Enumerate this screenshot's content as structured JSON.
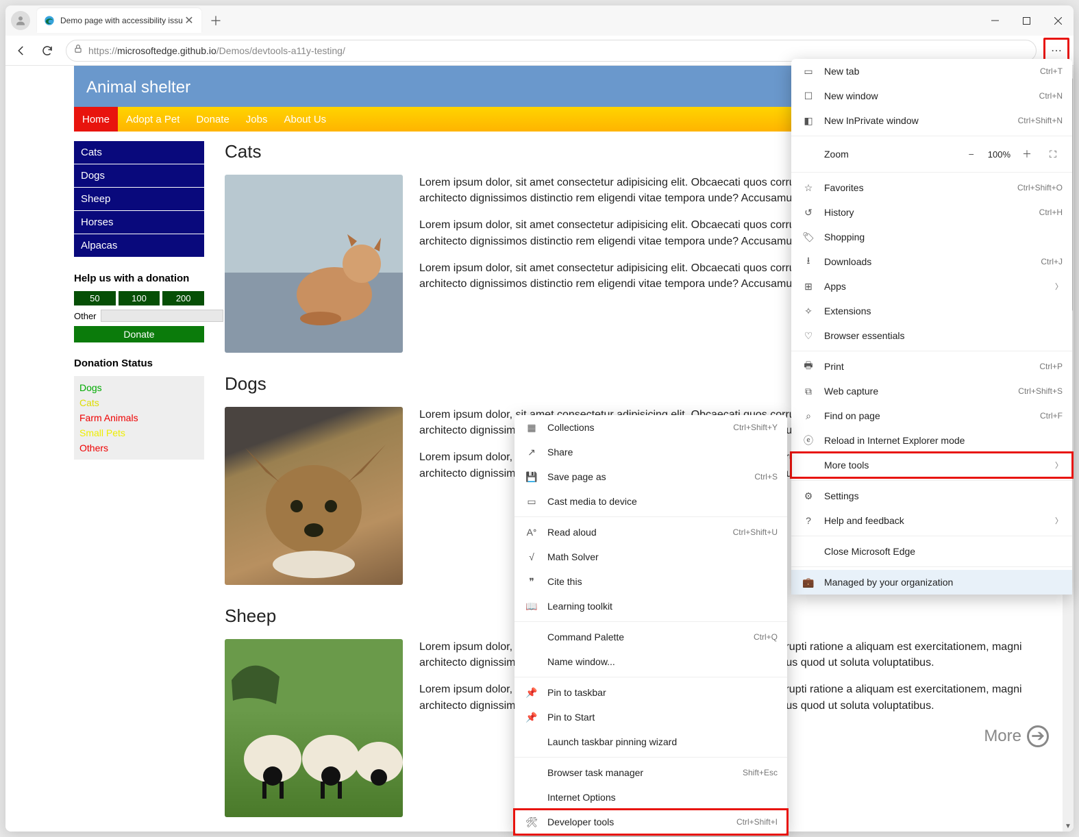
{
  "browser": {
    "tab_title": "Demo page with accessibility issu",
    "url_prefix": "https://",
    "url_host": "microsoftedge.github.io",
    "url_path": "/Demos/devtools-a11y-testing/"
  },
  "page": {
    "title": "Animal shelter",
    "nav": [
      "Home",
      "Adopt a Pet",
      "Donate",
      "Jobs",
      "About Us"
    ],
    "side_nav": [
      "Cats",
      "Dogs",
      "Sheep",
      "Horses",
      "Alpacas"
    ],
    "donation": {
      "heading": "Help us with a donation",
      "amounts": [
        "50",
        "100",
        "200"
      ],
      "other_label": "Other",
      "button": "Donate"
    },
    "status": {
      "heading": "Donation Status",
      "items": [
        {
          "label": "Dogs",
          "cls": "c-green"
        },
        {
          "label": "Cats",
          "cls": "c-yellow"
        },
        {
          "label": "Farm Animals",
          "cls": "c-red"
        },
        {
          "label": "Small Pets",
          "cls": "c-ylw2"
        },
        {
          "label": "Others",
          "cls": "c-red"
        }
      ]
    },
    "sections": {
      "cats": {
        "title": "Cats",
        "p1": "Lorem ipsum dolor, sit amet consectetur adipisicing elit. Obcaecati quos corrupti ratione a aliquam est exercitationem, magni architecto dignissimos distinctio rem eligendi vitae tempora unde? Accusamus quod ut soluta voluptatibus.",
        "p2": "Lorem ipsum dolor, sit amet consectetur adipisicing elit. Obcaecati quos corrupti ratione a aliquam est exercitationem, magni architecto dignissimos distinctio rem eligendi vitae tempora unde? Accusamus quod ut soluta voluptatibus.",
        "p3": "Lorem ipsum dolor, sit amet consectetur adipisicing elit. Obcaecati quos corrupti ratione a aliquam est exercitationem, magni architecto dignissimos distinctio rem eligendi vitae tempora unde? Accusamus quod ut soluta voluptatibus."
      },
      "dogs": {
        "title": "Dogs",
        "p1": "Lorem ipsum dolor, sit amet consectetur adipisicing elit. Obcaecati quos corrupti ratione a aliquam est exercitationem, magni architecto dignissimos distinctio rem eligendi vitae tempora unde? Accusamus quod ut soluta voluptatibus.",
        "p2": "Lorem ipsum dolor, sit amet consectetur adipisicing elit. Obcaecati quos corrupti ratione a aliquam est exercitationem, magni architecto dignissimos distinctio rem eligendi vitae tempora unde? Accusamus quod ut soluta voluptatibus."
      },
      "sheep": {
        "title": "Sheep",
        "p1": "Lorem ipsum dolor, sit amet consectetur adipisicing elit. Obcaecati quos corrupti ratione a aliquam est exercitationem, magni architecto dignissimos distinctio rem eligendi vitae tempora unde? Accusamus quod ut soluta voluptatibus.",
        "p2": "Lorem ipsum dolor, sit amet consectetur adipisicing elit. Obcaecati quos corrupti ratione a aliquam est exercitationem, magni architecto dignissimos distinctio rem eligendi vitae tempora unde? Accusamus quod ut soluta voluptatibus."
      }
    },
    "more_label": "More"
  },
  "menu": {
    "new_tab": "New tab",
    "new_tab_sc": "Ctrl+T",
    "new_window": "New window",
    "new_window_sc": "Ctrl+N",
    "new_inprivate": "New InPrivate window",
    "new_inprivate_sc": "Ctrl+Shift+N",
    "zoom": "Zoom",
    "zoom_val": "100%",
    "favorites": "Favorites",
    "favorites_sc": "Ctrl+Shift+O",
    "history": "History",
    "history_sc": "Ctrl+H",
    "shopping": "Shopping",
    "downloads": "Downloads",
    "downloads_sc": "Ctrl+J",
    "apps": "Apps",
    "extensions": "Extensions",
    "essentials": "Browser essentials",
    "print": "Print",
    "print_sc": "Ctrl+P",
    "webcapture": "Web capture",
    "webcapture_sc": "Ctrl+Shift+S",
    "find": "Find on page",
    "find_sc": "Ctrl+F",
    "reload_ie": "Reload in Internet Explorer mode",
    "more_tools": "More tools",
    "settings": "Settings",
    "help": "Help and feedback",
    "close_edge": "Close Microsoft Edge",
    "managed": "Managed by your organization"
  },
  "submenu": {
    "collections": "Collections",
    "collections_sc": "Ctrl+Shift+Y",
    "share": "Share",
    "save_as": "Save page as",
    "save_as_sc": "Ctrl+S",
    "cast": "Cast media to device",
    "read_aloud": "Read aloud",
    "read_aloud_sc": "Ctrl+Shift+U",
    "math": "Math Solver",
    "cite": "Cite this",
    "learning": "Learning toolkit",
    "cmd_palette": "Command Palette",
    "cmd_palette_sc": "Ctrl+Q",
    "name_window": "Name window...",
    "pin_taskbar": "Pin to taskbar",
    "pin_start": "Pin to Start",
    "pin_wizard": "Launch taskbar pinning wizard",
    "task_mgr": "Browser task manager",
    "task_mgr_sc": "Shift+Esc",
    "internet_opts": "Internet Options",
    "devtools": "Developer tools",
    "devtools_sc": "Ctrl+Shift+I"
  }
}
